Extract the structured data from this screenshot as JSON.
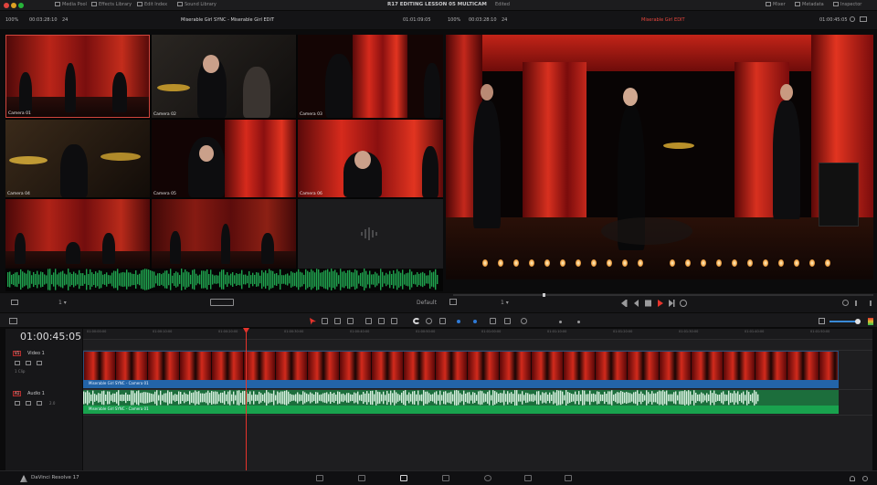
{
  "topbar": {
    "tabs": [
      "Media Pool",
      "Effects Library",
      "Edit Index",
      "Sound Library"
    ],
    "project_title": "R17 EDITING LESSON 05 MULTICAM",
    "project_status": "Edited",
    "right_tabs": [
      "Mixer",
      "Metadata",
      "Inspector"
    ]
  },
  "viewer_header": {
    "zoom_left": "100%",
    "tc_left": "00:03:28:10",
    "fps_left": "24",
    "clip_name": "Miserable Girl SYNC - Miserable Girl EDIT",
    "tc_mid": "01:01:09:05",
    "zoom_right": "100%",
    "tc_right": "00:03:28:10",
    "fps_right": "24",
    "program_name": "Miserable Girl EDIT",
    "tc_program": "01:00:45:05"
  },
  "multicam": {
    "cameras": [
      "Camera 01",
      "Camera 02",
      "Camera 03",
      "Camera 04",
      "Camera 05",
      "Camera 06",
      "",
      "",
      ""
    ],
    "active": "Camera 01",
    "footer_label": "Default"
  },
  "transport": {
    "left_label": "1 ▾",
    "mid_label": "1 ▾"
  },
  "timeline": {
    "timecode": "01:00:45:05",
    "ruler_ticks": [
      "01:00:00:00",
      "01:00:10:00",
      "01:00:20:00",
      "01:00:30:00",
      "01:00:40:00",
      "01:00:50:00",
      "01:01:00:00",
      "01:01:10:00",
      "01:01:20:00",
      "01:01:30:00",
      "01:01:40:00",
      "01:01:50:00"
    ],
    "tracks": [
      {
        "badge": "V1",
        "name": "Video 1",
        "sub": "1 Clip"
      },
      {
        "badge": "A1",
        "name": "Audio 1",
        "sub": "2.0"
      }
    ],
    "video_clip_label": "Miserable Girl SYNC - Camera 01",
    "audio_clip_label": "Miserable Girl SYNC - Camera 01"
  },
  "bottombar": {
    "app_name": "DaVinci Resolve 17"
  },
  "colors": {
    "playhead": "#e6342c",
    "video_clip": "#2364a8",
    "audio_clip": "#19a24e",
    "active_camera": "#d0453c"
  }
}
